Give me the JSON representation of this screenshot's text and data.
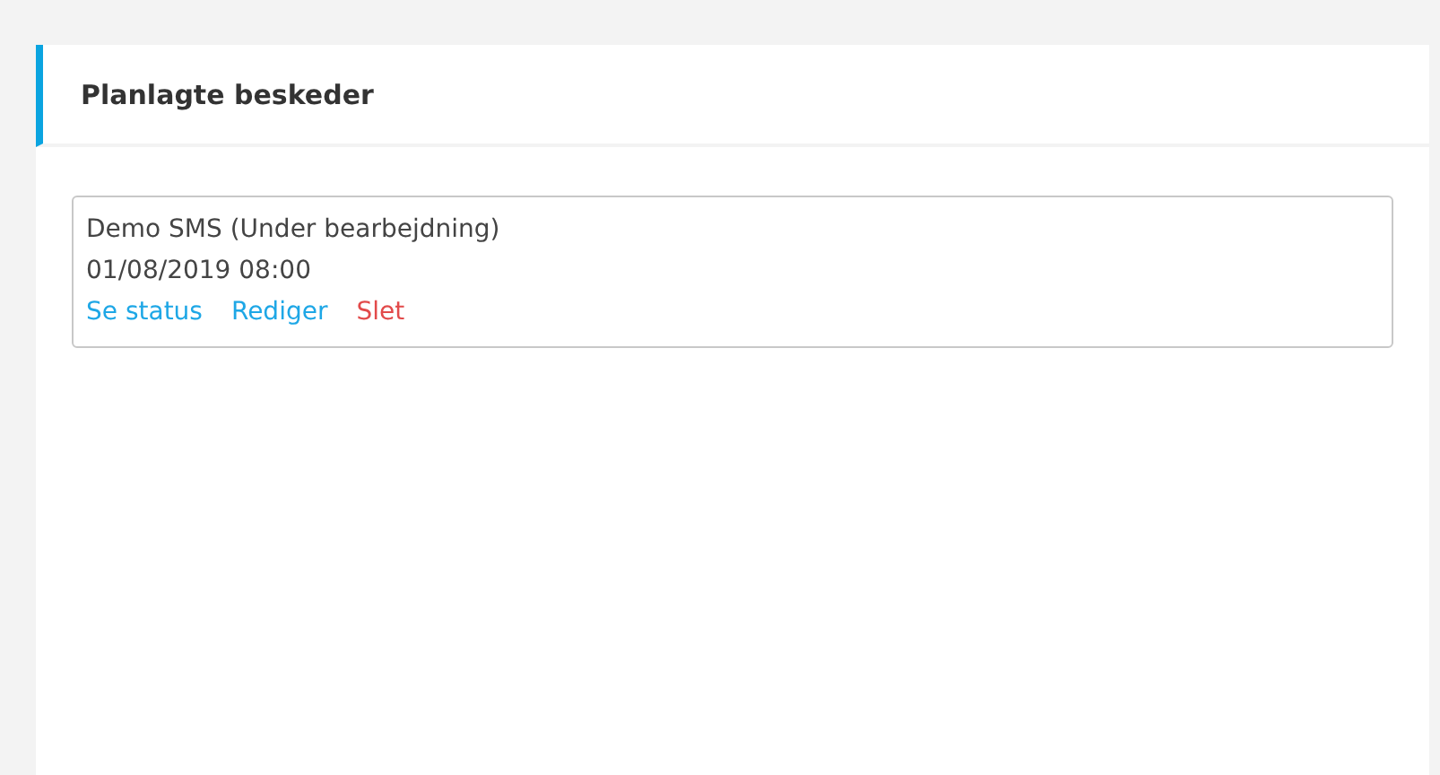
{
  "panel": {
    "title": "Planlagte beskeder"
  },
  "messages": [
    {
      "title": "Demo SMS (Under bearbejdning)",
      "time": "01/08/2019 08:00",
      "actions": [
        {
          "label": "Se status",
          "kind": "normal"
        },
        {
          "label": "Rediger",
          "kind": "normal"
        },
        {
          "label": "Slet",
          "kind": "danger"
        }
      ]
    }
  ]
}
